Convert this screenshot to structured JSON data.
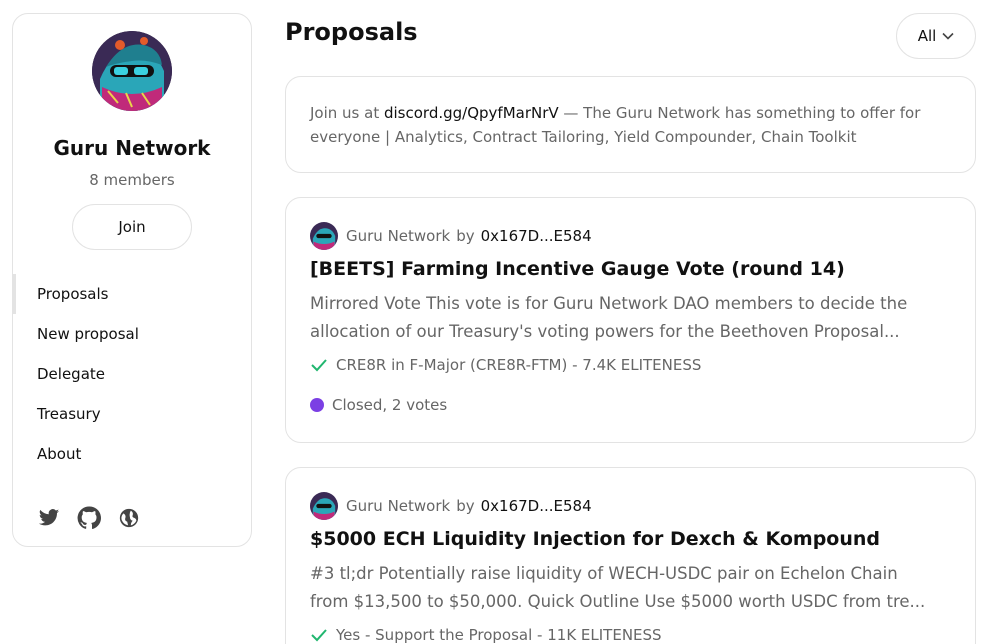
{
  "space": {
    "name": "Guru Network",
    "members": "8 members",
    "join_label": "Join"
  },
  "nav": [
    {
      "label": "Proposals"
    },
    {
      "label": "New proposal"
    },
    {
      "label": "Delegate"
    },
    {
      "label": "Treasury"
    },
    {
      "label": "About"
    }
  ],
  "socials": [
    "twitter-icon",
    "github-icon",
    "globe-icon"
  ],
  "main": {
    "title": "Proposals",
    "filter_label": "All"
  },
  "info": {
    "prefix": "Join us at ",
    "link": "discord.gg/QpyfMarNrV",
    "suffix": " — The Guru Network has something to offer for everyone | Analytics, Contract Tailoring, Yield Compounder, Chain Toolkit"
  },
  "proposals": [
    {
      "space": "Guru Network",
      "by": "by",
      "author": "0x167D...E584",
      "title": "[BEETS] Farming Incentive Gauge Vote (round 14)",
      "body": "Mirrored Vote This vote is for Guru Network DAO members to decide the allocation of our Treasury's voting powers for the Beethoven Proposal...",
      "result": "CRE8R in F-Major (CRE8R-FTM) - 7.4K ELITENESS",
      "status": "Closed, 2 votes"
    },
    {
      "space": "Guru Network",
      "by": "by",
      "author": "0x167D...E584",
      "title": "$5000 ECH Liquidity Injection for Dexch & Kompound",
      "body": "#3 tl;dr Potentially raise liquidity of WECH-USDC pair on Echelon Chain from $13,500 to $50,000. Quick Outline Use $5000 worth USDC from tre...",
      "result": "Yes - Support the Proposal - 11K ELITENESS"
    }
  ],
  "colors": {
    "border": "#e3e3e3",
    "muted_text": "#666666",
    "status_closed": "#7b3fe4",
    "check": "#21b66f"
  }
}
